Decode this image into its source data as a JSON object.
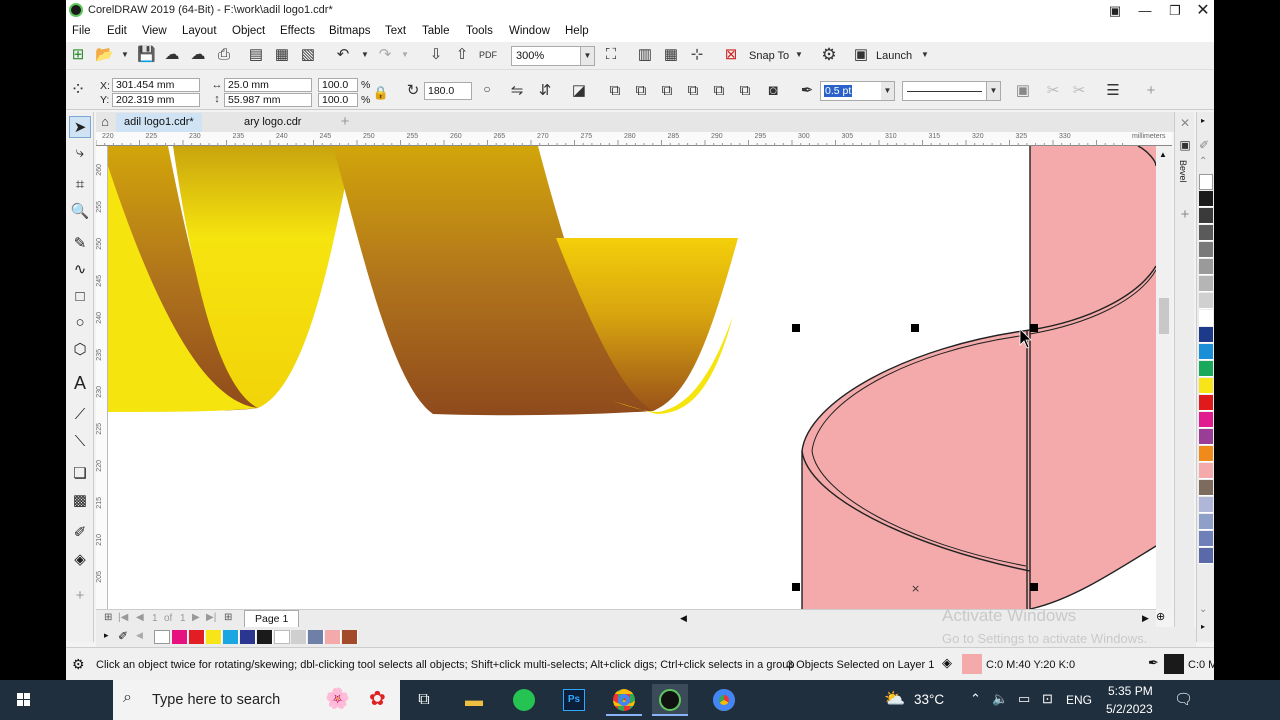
{
  "window": {
    "title": "CorelDRAW 2019 (64-Bit) - F:\\work\\adil logo1.cdr*",
    "controls": [
      "restore-icon",
      "minimize",
      "maximize",
      "close"
    ]
  },
  "menu": [
    "File",
    "Edit",
    "View",
    "Layout",
    "Object",
    "Effects",
    "Bitmaps",
    "Text",
    "Table",
    "Tools",
    "Window",
    "Help"
  ],
  "standard_toolbar": {
    "zoom_value": "300%",
    "snap_to_label": "Snap To",
    "launch_label": "Launch"
  },
  "property_bar": {
    "x_label": "X:",
    "x_value": "301.454 mm",
    "y_label": "Y:",
    "y_value": "202.319 mm",
    "width_value": "25.0 mm",
    "height_value": "55.987 mm",
    "scale_w": "100.0",
    "scale_h": "100.0",
    "pct1": "%",
    "pct2": "%",
    "rotation": "180.0",
    "outline_width": "0.5 pt"
  },
  "doc_tabs": [
    "adil logo1.cdr*",
    "ary logo.cdr"
  ],
  "ruler": {
    "top_ticks": [
      "220",
      "225",
      "230",
      "235",
      "240",
      "245",
      "250",
      "255",
      "260",
      "265",
      "270",
      "275",
      "280",
      "285",
      "290",
      "295",
      "300",
      "305",
      "310",
      "315",
      "320",
      "325",
      "330"
    ],
    "unit": "millimeters",
    "left_ticks": [
      "260",
      "255",
      "250",
      "245",
      "240",
      "235",
      "230",
      "225",
      "220",
      "215",
      "210",
      "205"
    ]
  },
  "docker": {
    "bevel_label": "Bevel"
  },
  "page_nav": {
    "page_num": "1",
    "of_label": "of",
    "page_total": "1",
    "page_tab": "Page 1"
  },
  "status": {
    "hint": "Click an object twice for rotating/skewing; dbl-clicking tool selects all objects; Shift+click multi-selects; Alt+click digs; Ctrl+click selects in a group",
    "selection": "3 Objects Selected on Layer 1",
    "fill_color": "C:0 M:40 Y:20 K:0",
    "outline_color": "C:0 M"
  },
  "watermark": {
    "line1": "Activate Windows",
    "line2": "Go to Settings to activate Windows."
  },
  "taskbar": {
    "search_placeholder": "Type here to search",
    "temperature": "33°C",
    "language": "ENG",
    "time": "5:35 PM",
    "date": "5/2/2023"
  },
  "colors": {
    "fill_pink": "#f4aaaa",
    "gold_light": "#f6e40e",
    "gold_dark": "#8f4a1c",
    "accent_blue": "#cfe3f5"
  },
  "palette_colors": [
    "#ffffff",
    "#1a1a1a",
    "#3a3a3a",
    "#5a5a5a",
    "#7a7a7a",
    "#9a9a9a",
    "#b5b5b5",
    "#d0d0d0",
    "#ffffff",
    "#1d3a8a",
    "#1a8fd6",
    "#1aa85a",
    "#f7e51a",
    "#e01a1a",
    "#e01a8f",
    "#9a3d96",
    "#f08a1a",
    "#f4aaaa",
    "#7d6b5e",
    "#b0b6d8",
    "#8fa0c8",
    "#6f7fb8",
    "#5a6aa8"
  ],
  "doc_palette_colors": [
    "#e6117e",
    "#e31d24",
    "#f7e51a",
    "#1aa6e0",
    "#2b3690",
    "#1a1a1a",
    "#ffffff",
    "#cfcfcf",
    "#6f80a8",
    "#f4aaaa",
    "#a34a2a"
  ]
}
